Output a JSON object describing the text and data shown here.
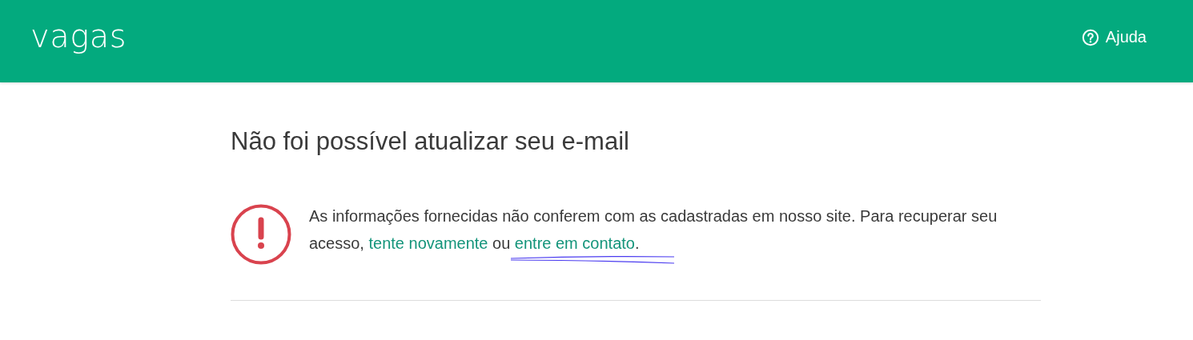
{
  "header": {
    "logo": "vagas",
    "help_link": "Ajuda"
  },
  "title": "Não foi possível atualizar seu e-mail",
  "message": [
    {
      "kind": "text",
      "text": "As informações fornecidas não conferem com as cadastradas em nosso site. Para recuperar seu acesso, "
    },
    {
      "kind": "link",
      "text": "tente novamente"
    },
    {
      "kind": "text",
      "text": " ou "
    },
    {
      "kind": "link",
      "text": "entre em contato"
    },
    {
      "kind": "text",
      "text": "."
    }
  ]
}
